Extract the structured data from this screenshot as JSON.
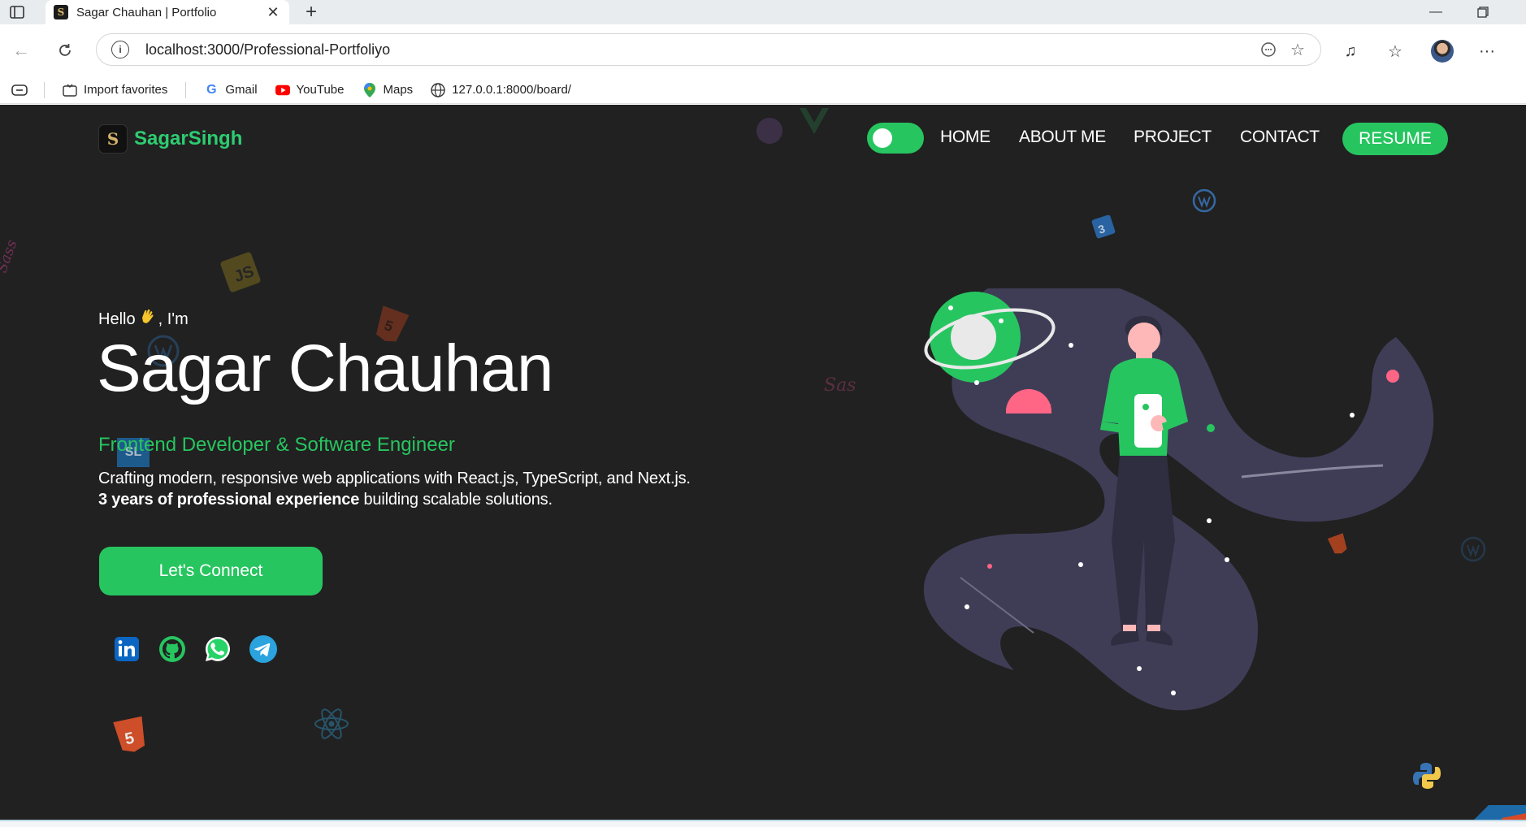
{
  "browser": {
    "tab_title": "Sagar Chauhan | Portfolio",
    "url": "localhost:3000/Professional-Portfoliyo",
    "favorites": [
      {
        "label": "Import favorites"
      },
      {
        "label": "Gmail"
      },
      {
        "label": "YouTube"
      },
      {
        "label": "Maps"
      },
      {
        "label": "127.0.0.1:8000/board/"
      }
    ]
  },
  "site": {
    "brand": "SagarSingh",
    "nav": [
      "HOME",
      "ABOUT ME",
      "PROJECT",
      "CONTACT"
    ],
    "resume_label": "RESUME",
    "theme_toggle_on": true
  },
  "hero": {
    "greeting_before": "Hello",
    "greeting_after": ", I'm",
    "name": "Sagar Chauhan",
    "role": "Frontend Developer & Software Engineer",
    "desc_line1": "Crafting modern, responsive web applications with React.js, TypeScript, and Next.js.",
    "desc_bold": "3 years of professional experience",
    "desc_rest": " building scalable solutions.",
    "cta_label": "Let's Connect"
  },
  "socials": [
    "linkedin-icon",
    "github-icon",
    "whatsapp-icon",
    "telegram-icon"
  ],
  "colors": {
    "accent": "#27c560",
    "background": "#212121",
    "illustration_blob": "#3f3d56",
    "pink": "#ff6584"
  }
}
